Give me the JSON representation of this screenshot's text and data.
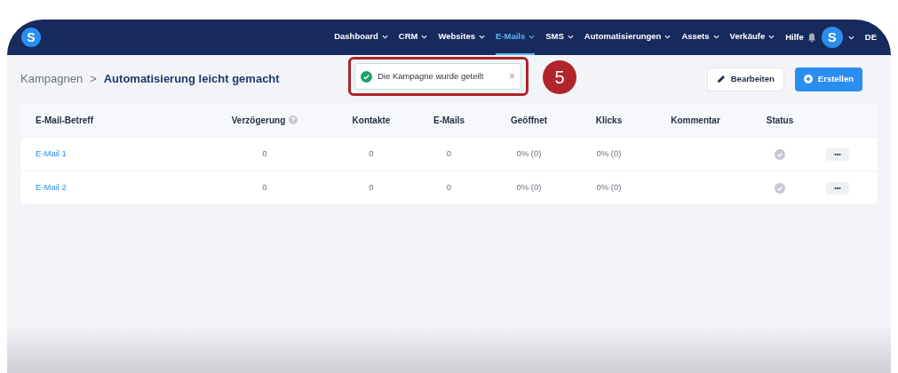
{
  "logo": "S",
  "nav": [
    {
      "label": "Dashboard",
      "selected": false
    },
    {
      "label": "CRM",
      "selected": false
    },
    {
      "label": "Websites",
      "selected": false
    },
    {
      "label": "E-Mails",
      "selected": true
    },
    {
      "label": "SMS",
      "selected": false
    },
    {
      "label": "Automatisierungen",
      "selected": false
    },
    {
      "label": "Assets",
      "selected": false
    },
    {
      "label": "Verkäufe",
      "selected": false
    }
  ],
  "help": "Hilfe",
  "avatar": "S",
  "language": "DE",
  "breadcrumb": {
    "parent": "Kampagnen",
    "separator": ">",
    "current": "Automatisierung leicht gemacht"
  },
  "toast": {
    "message": "Die Kampagne wurde geteilt",
    "close": "×"
  },
  "annotation": {
    "number": "5"
  },
  "buttons": [
    {
      "label": "Bearbeiten",
      "kind": "secondary"
    },
    {
      "label": "Erstellen",
      "kind": "primary"
    }
  ],
  "table": {
    "columns": [
      "E-Mail-Betreff",
      "Verzögerung",
      "Kontakte",
      "E-Mails",
      "Geöffnet",
      "Klicks",
      "Kommentar",
      "Status"
    ],
    "rows": [
      {
        "subject": "E-Mail 1",
        "delay": "0",
        "contacts": "0",
        "emails": "0",
        "opened": "0% (0)",
        "clicks": "0% (0)",
        "menu": "•••"
      },
      {
        "subject": "E-Mail 2",
        "delay": "0",
        "contacts": "0",
        "emails": "0",
        "opened": "0% (0)",
        "clicks": "0% (0)",
        "menu": "•••"
      }
    ]
  }
}
